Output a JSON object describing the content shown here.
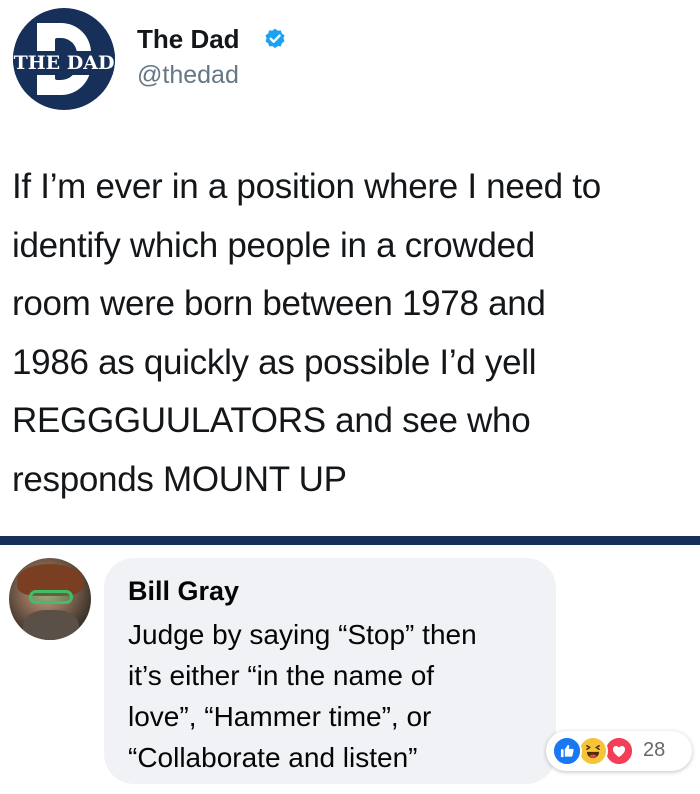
{
  "tweet": {
    "logo_text": "THE DAD",
    "display_name": "The Dad",
    "handle": "@thedad",
    "lines": [
      "If I’m ever in a position where I need to",
      "identify which people in a crowded",
      "room were born between 1978 and",
      "1986 as quickly as possible I’d yell",
      "REGGGUULATORS and see who",
      "responds MOUNT UP"
    ],
    "icons": {
      "verified": "verified-badge-icon"
    }
  },
  "comment": {
    "name": "Bill Gray",
    "lines": [
      "Judge by saying “Stop” then",
      "it’s either “in the name of",
      "love”, “Hammer time”, or",
      "“Collaborate and listen”"
    ],
    "reaction_count": "28",
    "reactions": [
      "like-icon",
      "haha-icon",
      "love-icon"
    ]
  },
  "colors": {
    "brand_navy": "#16305a",
    "verified_blue": "#1da1f2",
    "handle_gray": "#657786",
    "bubble_bg": "#f0f2f5",
    "like_blue": "#1877f2",
    "haha_yellow": "#f7c33b",
    "love_red": "#f33e58"
  }
}
